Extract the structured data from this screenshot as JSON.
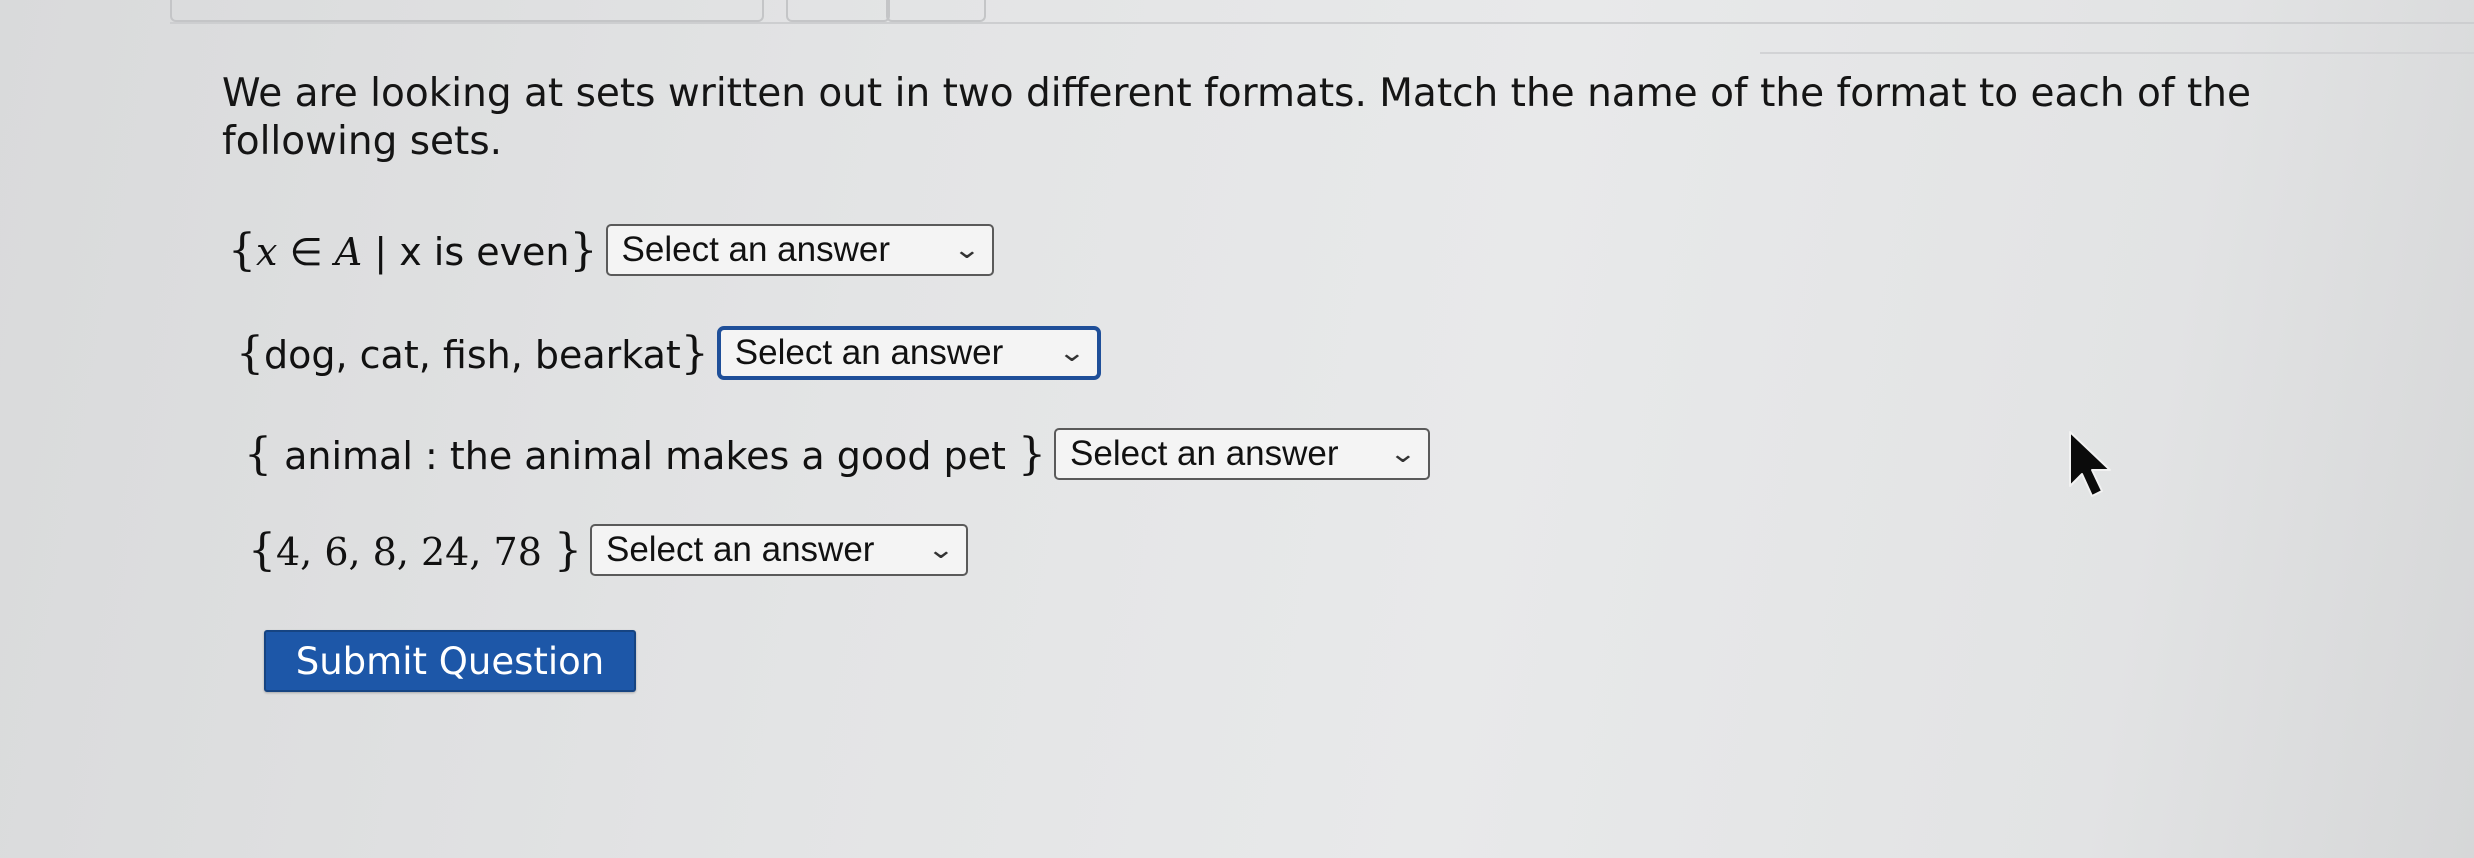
{
  "question": {
    "text": "We are looking at sets written out in two different formats. Match the name of the format to each of the following sets."
  },
  "items": [
    {
      "open": "{",
      "variable": "x",
      "element_of": "∈",
      "set_name": "A",
      "separator": "|",
      "condition": "x is even",
      "close": "}",
      "select_value": "Select an answer"
    },
    {
      "open": "{",
      "content": "dog, cat, fish, bearkat",
      "close": "}",
      "select_value": "Select an answer"
    },
    {
      "open": "{",
      "content": "animal : the animal makes a good pet",
      "close": "}",
      "select_value": "Select an answer"
    },
    {
      "open": "{",
      "content": "4, 6, 8, 24, 78",
      "close": "}",
      "select_value": "Select an answer"
    }
  ],
  "submit": {
    "label": "Submit Question"
  },
  "icons": {
    "dropdown": "chevron-down-icon",
    "pointer": "mouse-pointer-icon"
  },
  "colors": {
    "accent": "#1d57a8",
    "focus_border": "#1f4f99"
  }
}
